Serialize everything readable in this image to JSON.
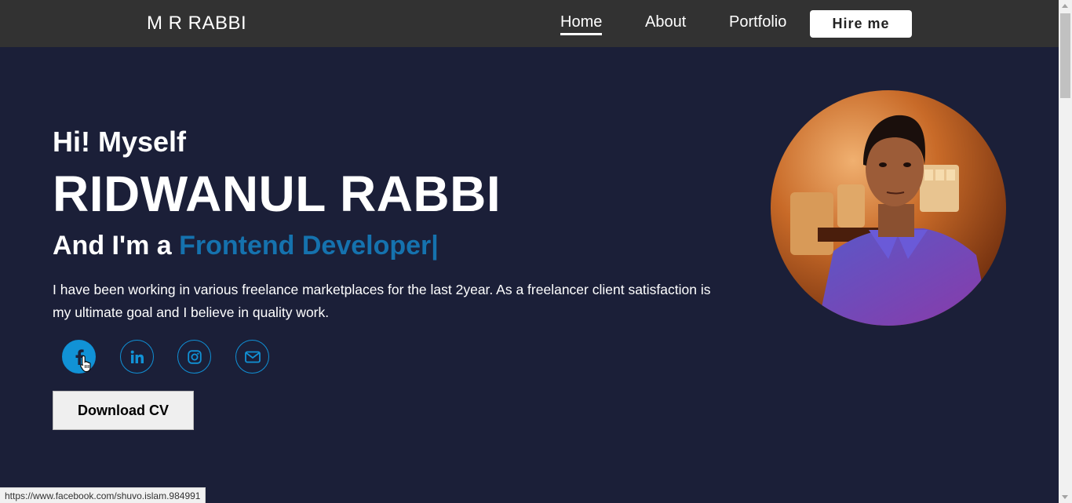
{
  "nav": {
    "logo": "M R RABBI",
    "links": [
      "Home",
      "About",
      "Portfolio"
    ],
    "hire_label": "Hire me"
  },
  "hero": {
    "greeting": "Hi! Myself",
    "name": "RIDWANUL RABBI",
    "role_prefix": "And I'm a ",
    "role": "Frontend Developer|",
    "bio": "I have been working in various freelance marketplaces for the last 2year. As a freelancer client satisfaction is my ultimate goal and I believe in quality work.",
    "cv_label": "Download CV"
  },
  "social_icons": [
    "facebook-icon",
    "linkedin-icon",
    "instagram-icon",
    "envelope-icon"
  ],
  "status_bar": {
    "url": "https://www.facebook.com/shuvo.islam.984991"
  },
  "colors": {
    "navbar": "#323232",
    "background": "#1b1f38",
    "accent": "#1572ae",
    "icon_blue": "#1192d6"
  }
}
